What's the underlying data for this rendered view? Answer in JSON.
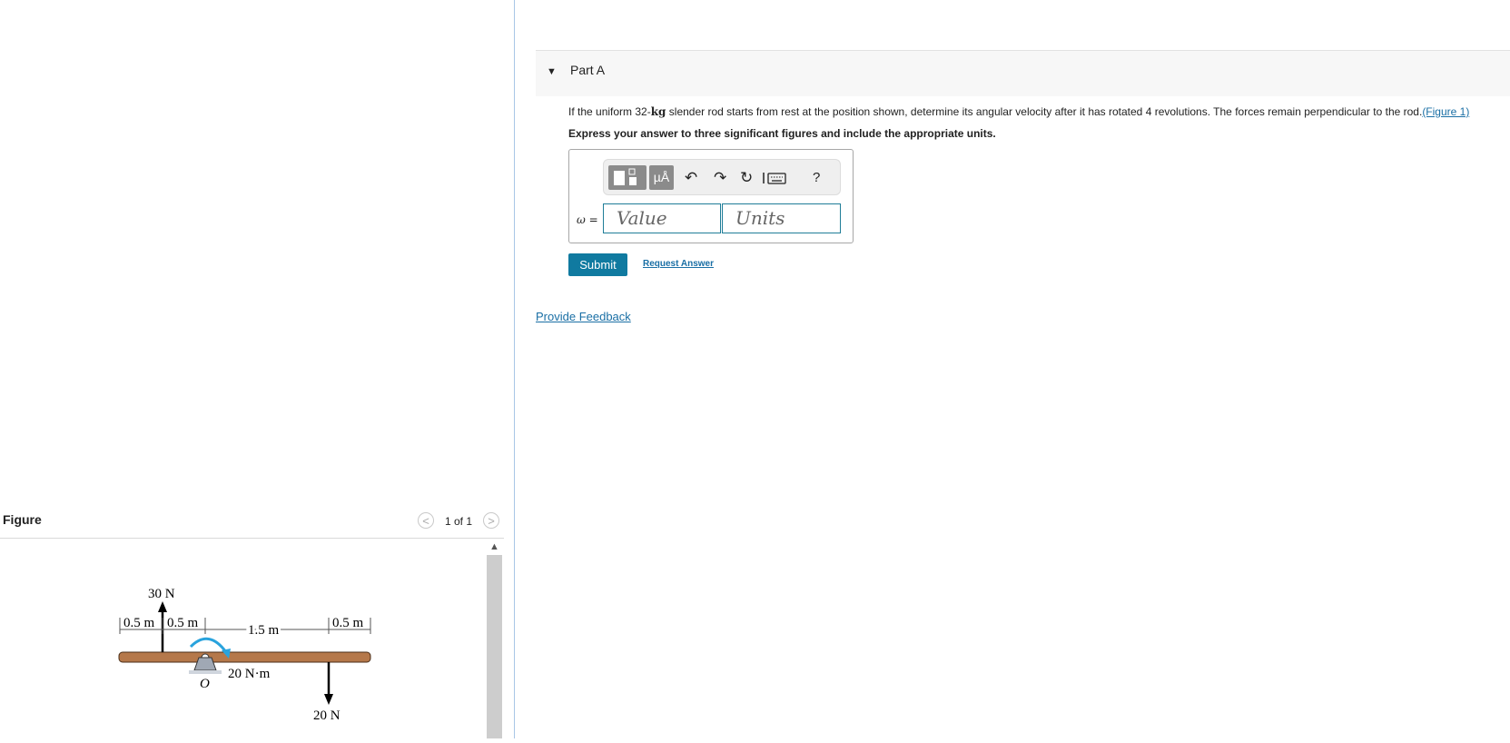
{
  "figure": {
    "title": "Figure",
    "pager": "1 of 1",
    "prev_glyph": "<",
    "next_glyph": ">",
    "labels": {
      "force_up": "30 N",
      "force_down": "20 N",
      "moment": "20 N·m",
      "pivot": "O",
      "dim1": "0.5 m",
      "dim2": "0.5 m",
      "dim3": "1.5 m",
      "dim4": "0.5 m"
    }
  },
  "part": {
    "title": "Part A",
    "question_prefix": "If the uniform 32-",
    "question_unit": "kg",
    "question_suffix": " slender rod starts from rest at the position shown, determine its angular velocity after it has rotated 4 revolutions. The forces remain perpendicular to the rod.",
    "figure_link": "(Figure 1)",
    "instruction": "Express your answer to three significant figures and include the appropriate units."
  },
  "answer": {
    "variable_label": "ω =",
    "value_placeholder": "Value",
    "units_placeholder": "Units"
  },
  "toolbar": {
    "units_button": "µÅ",
    "help": "?"
  },
  "actions": {
    "submit": "Submit",
    "request": "Request Answer",
    "feedback": "Provide Feedback"
  },
  "colors": {
    "accent": "#107aa0",
    "link": "#1a6fa5",
    "rod": "#b5784a",
    "moment_arrow": "#29a3dd"
  }
}
